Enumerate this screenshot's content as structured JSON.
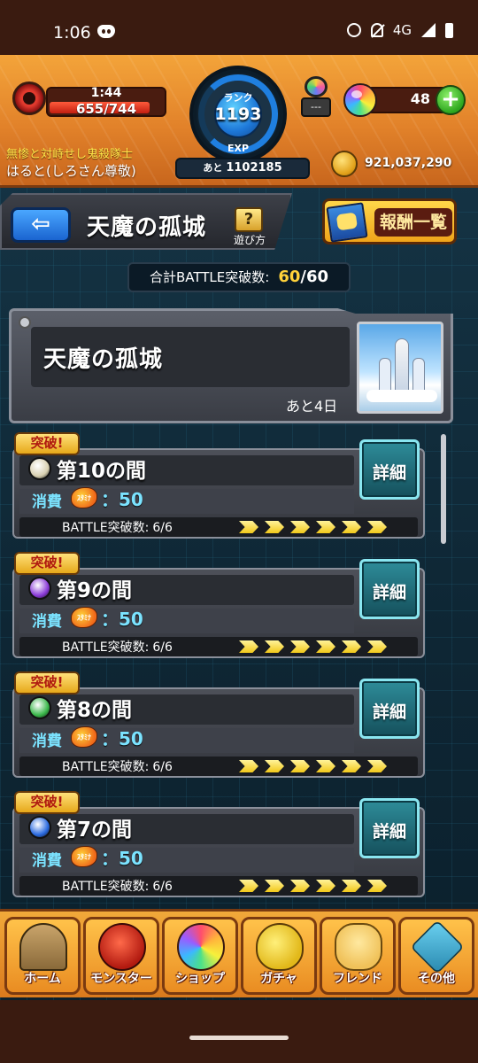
{
  "status_bar": {
    "time": "1:06",
    "network": "4G"
  },
  "header": {
    "stamina_time": "1:44",
    "stamina_value": "655/744",
    "stamina_fraction": 0.88,
    "rank_label": "ランク",
    "rank_value": "1193",
    "exp_label": "EXP",
    "exp_prefix": "あと",
    "exp_remaining": "1102185",
    "gauge_value": "---",
    "orb_count": "48",
    "plus_label": "+",
    "guild_name": "無惨と対峙せし鬼殺隊士",
    "player_name": "はると(しろさん尊敬)",
    "coins": "921,037,290"
  },
  "title_bar": {
    "back_label": "⇦",
    "title": "天魔の孤城",
    "help_icon": "?",
    "help_label": "遊び方",
    "reward_label": "報酬一覧"
  },
  "total": {
    "label": "合計BATTLE突破数:",
    "current": "60",
    "max": "/60"
  },
  "banner": {
    "title": "天魔の孤城",
    "days_left": "あと4日"
  },
  "floors": [
    {
      "badge": "突破!",
      "name": "第10の間",
      "cost_label": "消費",
      "stamina_icon_text": "ｽﾀﾐﾅ",
      "cost": "：50",
      "battle_label": "BATTLE突破数:",
      "battle_value": "6/6",
      "detail_label": "詳細",
      "element": "light",
      "color": "#d8d0b0"
    },
    {
      "badge": "突破!",
      "name": "第9の間",
      "cost_label": "消費",
      "stamina_icon_text": "ｽﾀﾐﾅ",
      "cost": "：50",
      "battle_label": "BATTLE突破数:",
      "battle_value": "6/6",
      "detail_label": "詳細",
      "element": "dark",
      "color": "#8a3ad8"
    },
    {
      "badge": "突破!",
      "name": "第8の間",
      "cost_label": "消費",
      "stamina_icon_text": "ｽﾀﾐﾅ",
      "cost": "：50",
      "battle_label": "BATTLE突破数:",
      "battle_value": "6/6",
      "detail_label": "詳細",
      "element": "wood",
      "color": "#3ab84a"
    },
    {
      "badge": "突破!",
      "name": "第7の間",
      "cost_label": "消費",
      "stamina_icon_text": "ｽﾀﾐﾅ",
      "cost": "：50",
      "battle_label": "BATTLE突破数:",
      "battle_value": "6/6",
      "detail_label": "詳細",
      "element": "water",
      "color": "#2a6ae0"
    }
  ],
  "nav": [
    {
      "label": "ホーム",
      "icon": "home-icon"
    },
    {
      "label": "モンスター",
      "icon": "monster-icon"
    },
    {
      "label": "ショップ",
      "icon": "shop-icon"
    },
    {
      "label": "ガチャ",
      "icon": "gacha-icon"
    },
    {
      "label": "フレンド",
      "icon": "friend-icon"
    },
    {
      "label": "その他",
      "icon": "other-icon"
    }
  ]
}
